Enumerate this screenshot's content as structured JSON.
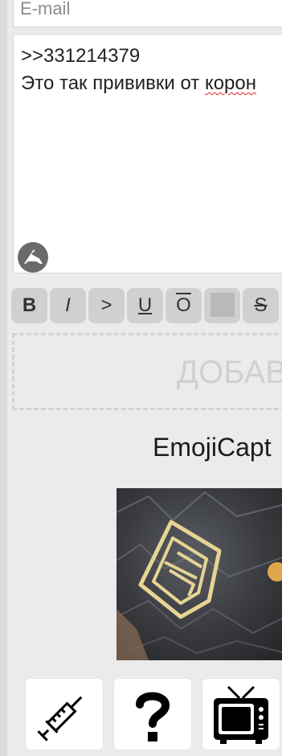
{
  "form": {
    "email_placeholder": "E-mail",
    "comment_line1": ">>331214379",
    "comment_line2_start": "Это так прививки от ",
    "comment_line2_misspelled": "корон"
  },
  "toolbar": {
    "bold": "B",
    "italic": "I",
    "quote": ">",
    "underline": "U",
    "overline": "O",
    "spoiler": "",
    "strike": "S"
  },
  "dropzone": {
    "label": "ДОБАВ"
  },
  "captcha": {
    "title": "EmojiCapt",
    "options": [
      "syringe-icon",
      "question-mark-icon",
      "television-icon"
    ]
  },
  "colors": {
    "background": "#ebebeb",
    "button": "#d0d0d0",
    "misspelling": "#e02020"
  }
}
